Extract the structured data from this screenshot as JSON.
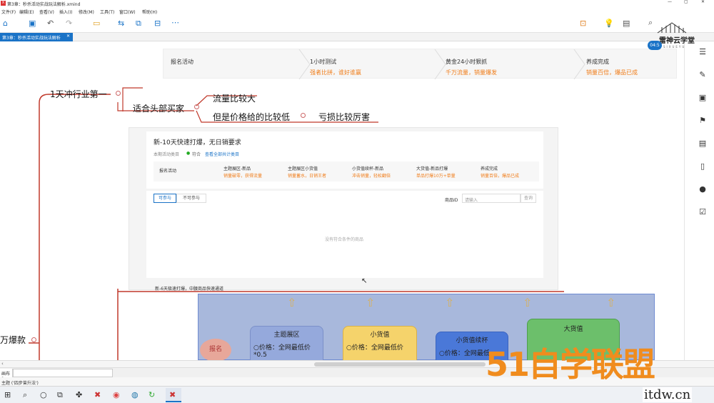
{
  "window": {
    "title": "第3章：秒杀活动实战玩法解析.xmind"
  },
  "menu": [
    "文件(F)",
    "编辑(E)",
    "查看(V)",
    "插入(I)",
    "修改(M)",
    "工具(T)",
    "窗口(W)",
    "帮助(H)"
  ],
  "tab": {
    "label": "第3章：秒杀活动实战玩法解析"
  },
  "mindmap": {
    "node1": "1天冲行业第一",
    "node2": "适合头部买家",
    "node3": "流量比较大",
    "node4": "但是价格给的比较低",
    "node5": "亏损比较厉害",
    "node6": "万爆款"
  },
  "top_panel": {
    "steps": [
      {
        "title": "报名活动",
        "sub": ""
      },
      {
        "title": "1小时测试",
        "sub": "强者比拼，谁好谁赢"
      },
      {
        "title": "黄金24小时狠抓",
        "sub": "千万流量，销量爆发"
      },
      {
        "title": "养成完成",
        "sub": "销量百倍，爆品已成"
      }
    ]
  },
  "mid_panel": {
    "title": "新-10天快速打爆，无日销要求",
    "meta": "本期活动类目",
    "meta_status": "符合",
    "meta_link": "查看全部共计类目",
    "steps": [
      {
        "title": "报名活动",
        "sub": ""
      },
      {
        "title": "主题展区-新品",
        "sub": "销量破零，获得流量"
      },
      {
        "title": "主题展区小货值",
        "sub": "销量蓄水，日销王者"
      },
      {
        "title": "小货值续杯-新品",
        "sub": "冲击销量，轻松翻倍"
      },
      {
        "title": "大货值-新品打爆",
        "sub": "单品打爆10万+单量"
      },
      {
        "title": "养成完成",
        "sub": "销量百倍，爆品已成"
      }
    ],
    "tab_join": "可参与",
    "tab_nojoin": "不可参与",
    "search_label": "商品ID",
    "search_placeholder": "请输入",
    "search_btn": "查询",
    "empty": "没有符合条件的商品",
    "next_title": "新-6天极速打爆，中腰商品快速通道"
  },
  "flow": {
    "boxes": [
      {
        "title": "主题展区",
        "l1": "○价格：全网最低价",
        "l2": "*0.5"
      },
      {
        "title": "小货值",
        "l1": "○价格：全网最低价",
        "l2": ""
      },
      {
        "title": "小货值续杯",
        "l1": "○价格：全网最低",
        "l2": ""
      },
      {
        "title": "大货值",
        "l1": "",
        "l2": ""
      }
    ],
    "left_label": "报名"
  },
  "sheetbar": {
    "label": "画布 1"
  },
  "statusbar": {
    "text": "主题 ('四步曾升法')"
  },
  "logo": {
    "text": "雷神云学堂",
    "sub": "SIXUEYU",
    "badge": "04:5"
  },
  "watermark": {
    "main": "51自学联盟",
    "sub": "itdw.cn"
  },
  "colors": {
    "accent": "#1a73c7",
    "red_line": "#c0392b",
    "orange": "#f07d1a"
  }
}
